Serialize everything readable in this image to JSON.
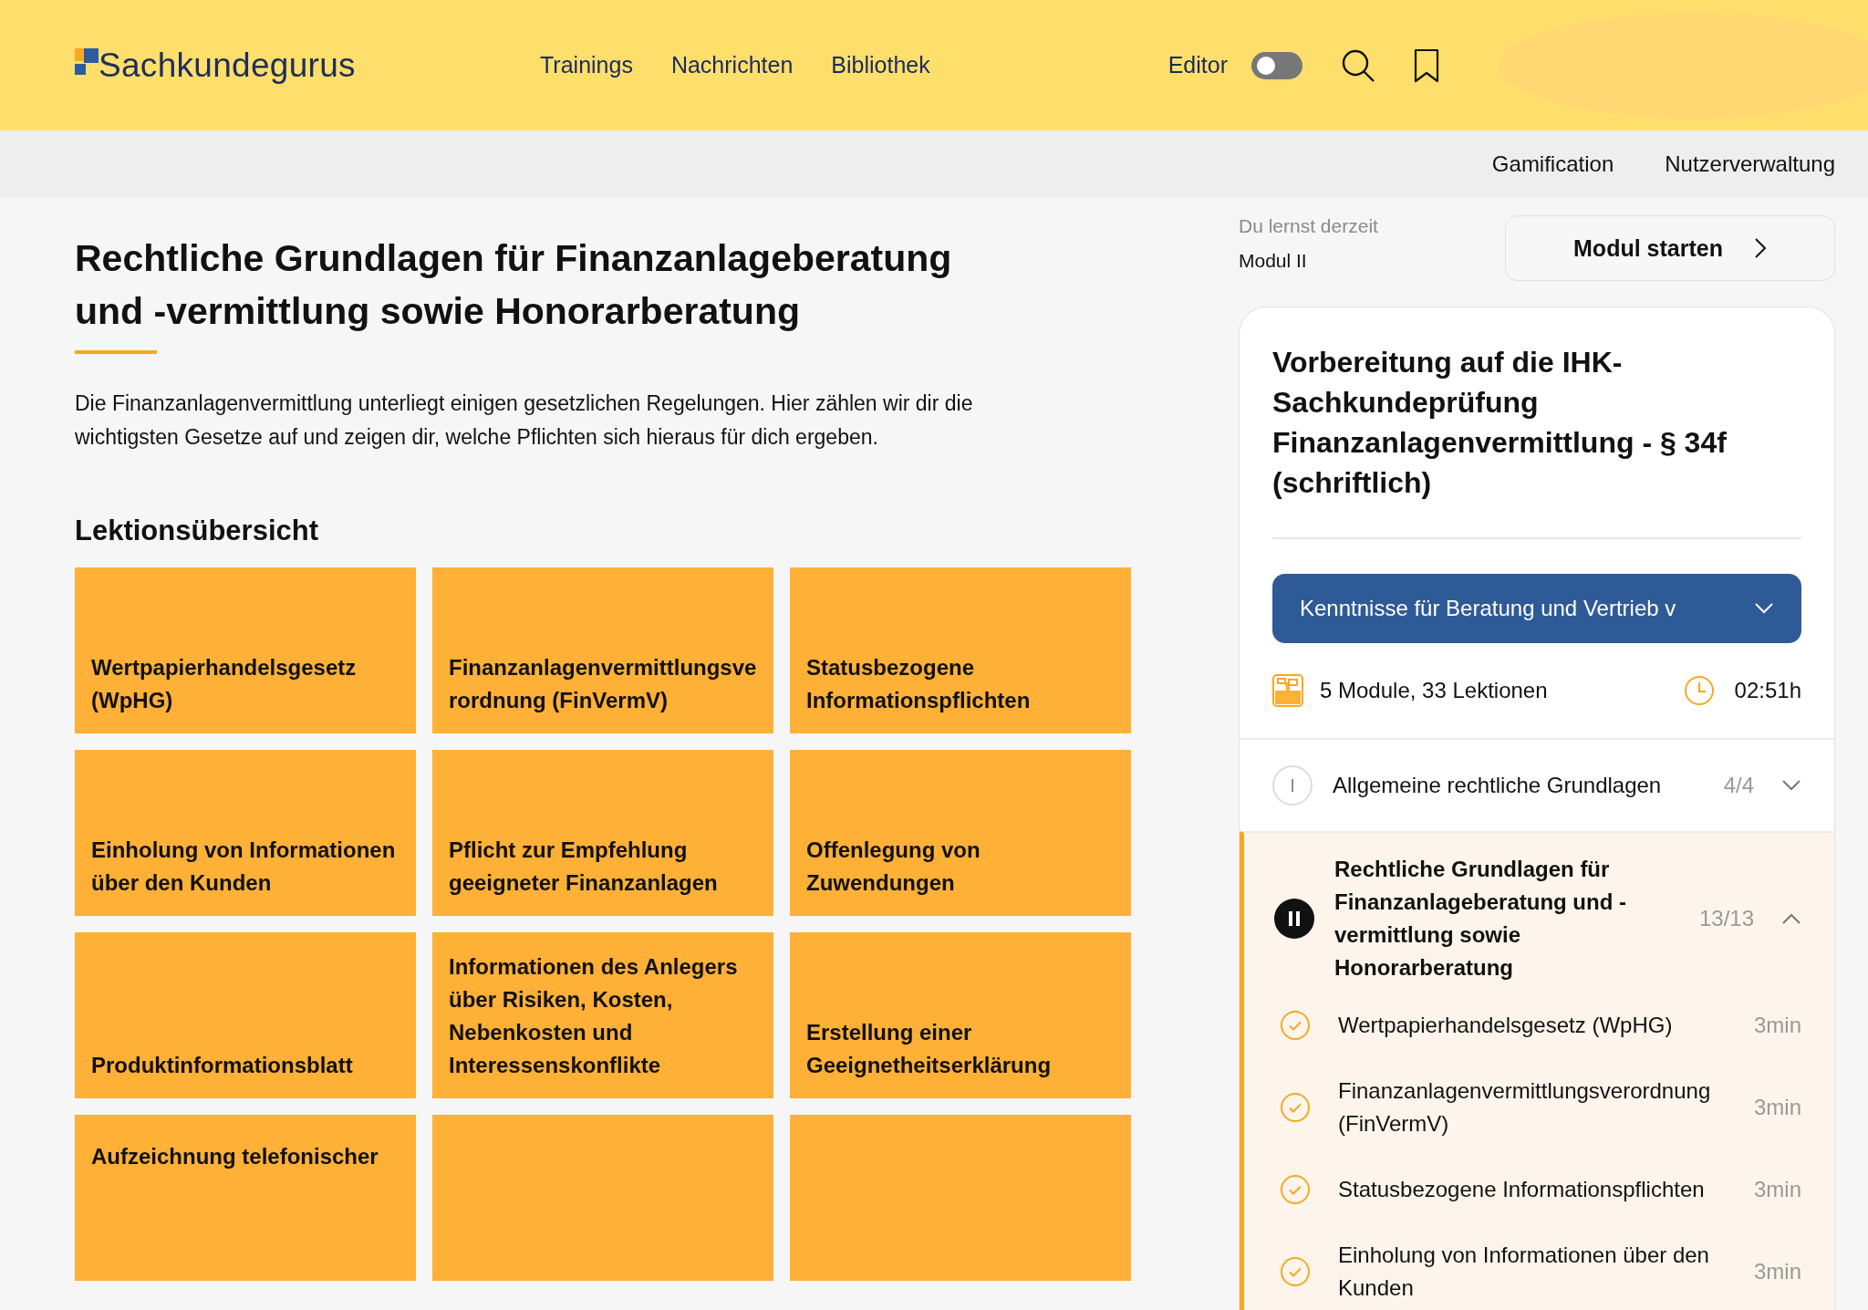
{
  "header": {
    "logo": "Sachkundegurus",
    "nav": [
      {
        "label": "Trainings"
      },
      {
        "label": "Nachrichten"
      },
      {
        "label": "Bibliothek"
      }
    ],
    "editor": {
      "label": "Editor",
      "on": false
    }
  },
  "subnav": [
    "Gamification",
    "Nutzerverwaltung"
  ],
  "course": {
    "title": "Rechtliche Grundlagen für Finanzanlageberatung und -vermittlung sowie Honorarberatung",
    "description": "Die Finanzanlagenvermittlung unterliegt einigen gesetzlichen Regelungen. Hier zählen wir dir die wichtigsten Gesetze auf und zeigen dir, welche Pflichten sich hieraus für dich ergeben.",
    "lessons_heading": "Lektionsübersicht",
    "lessons": [
      {
        "kind": "titled",
        "title": "Wertpapierhandelsgesetz (WpHG)"
      },
      {
        "kind": "titled",
        "title": "Finanzanlagenvermittlungsverordnung (FinVermV)"
      },
      {
        "kind": "titled",
        "title": "Statusbezogene Informationspflichten"
      },
      {
        "kind": "titled",
        "title": "Einholung von Informationen über den Kunden"
      },
      {
        "kind": "titled",
        "title": "Pflicht zur Empfehlung geeigneter Finanzanlagen"
      },
      {
        "kind": "titled",
        "title": "Offenlegung von Zuwendungen"
      },
      {
        "kind": "titled",
        "title": "Produktinformationsblatt"
      },
      {
        "kind": "titled",
        "title": "Informationen des Anlegers über Risiken, Kosten, Nebenkosten und Interessenskonflikte"
      },
      {
        "kind": "titled",
        "title": "Erstellung einer Geeignetheitserklärung"
      },
      {
        "kind": "cut",
        "title": "Aufzeichnung telefonischer"
      },
      {
        "kind": "blank"
      },
      {
        "kind": "blank"
      }
    ]
  },
  "current": {
    "label": "Du lernst derzeit",
    "module": "Modul II",
    "button": "Modul starten"
  },
  "training": {
    "title": "Vorbereitung auf die IHK-Sachkundeprüfung Finanzanlagenvermittlung - § 34f (schriftlich)",
    "section": "Kenntnisse für Beratung und Vertrieb v",
    "stats": "5 Module, 33 Lektionen",
    "duration": "02:51h",
    "modules": [
      {
        "numeral": "I",
        "title": "Allgemeine rechtliche Grundlagen",
        "progress": "4/4",
        "active": false,
        "expanded": false
      },
      {
        "title": "Rechtliche Grundlagen für Finanzanlageberatung und -vermittlung sowie Honorarberatung",
        "progress": "13/13",
        "active": true,
        "expanded": true,
        "lessons": [
          {
            "title": "Wertpapierhandelsgesetz (WpHG)",
            "duration": "3min",
            "done": true
          },
          {
            "title": "Finanzanlagenvermittlungsverordnung (FinVermV)",
            "duration": "3min",
            "done": true
          },
          {
            "title": "Statusbezogene Informationspflichten",
            "duration": "3min",
            "done": true
          },
          {
            "title": "Einholung von Informationen über den Kunden",
            "duration": "3min",
            "done": true
          }
        ]
      }
    ]
  }
}
